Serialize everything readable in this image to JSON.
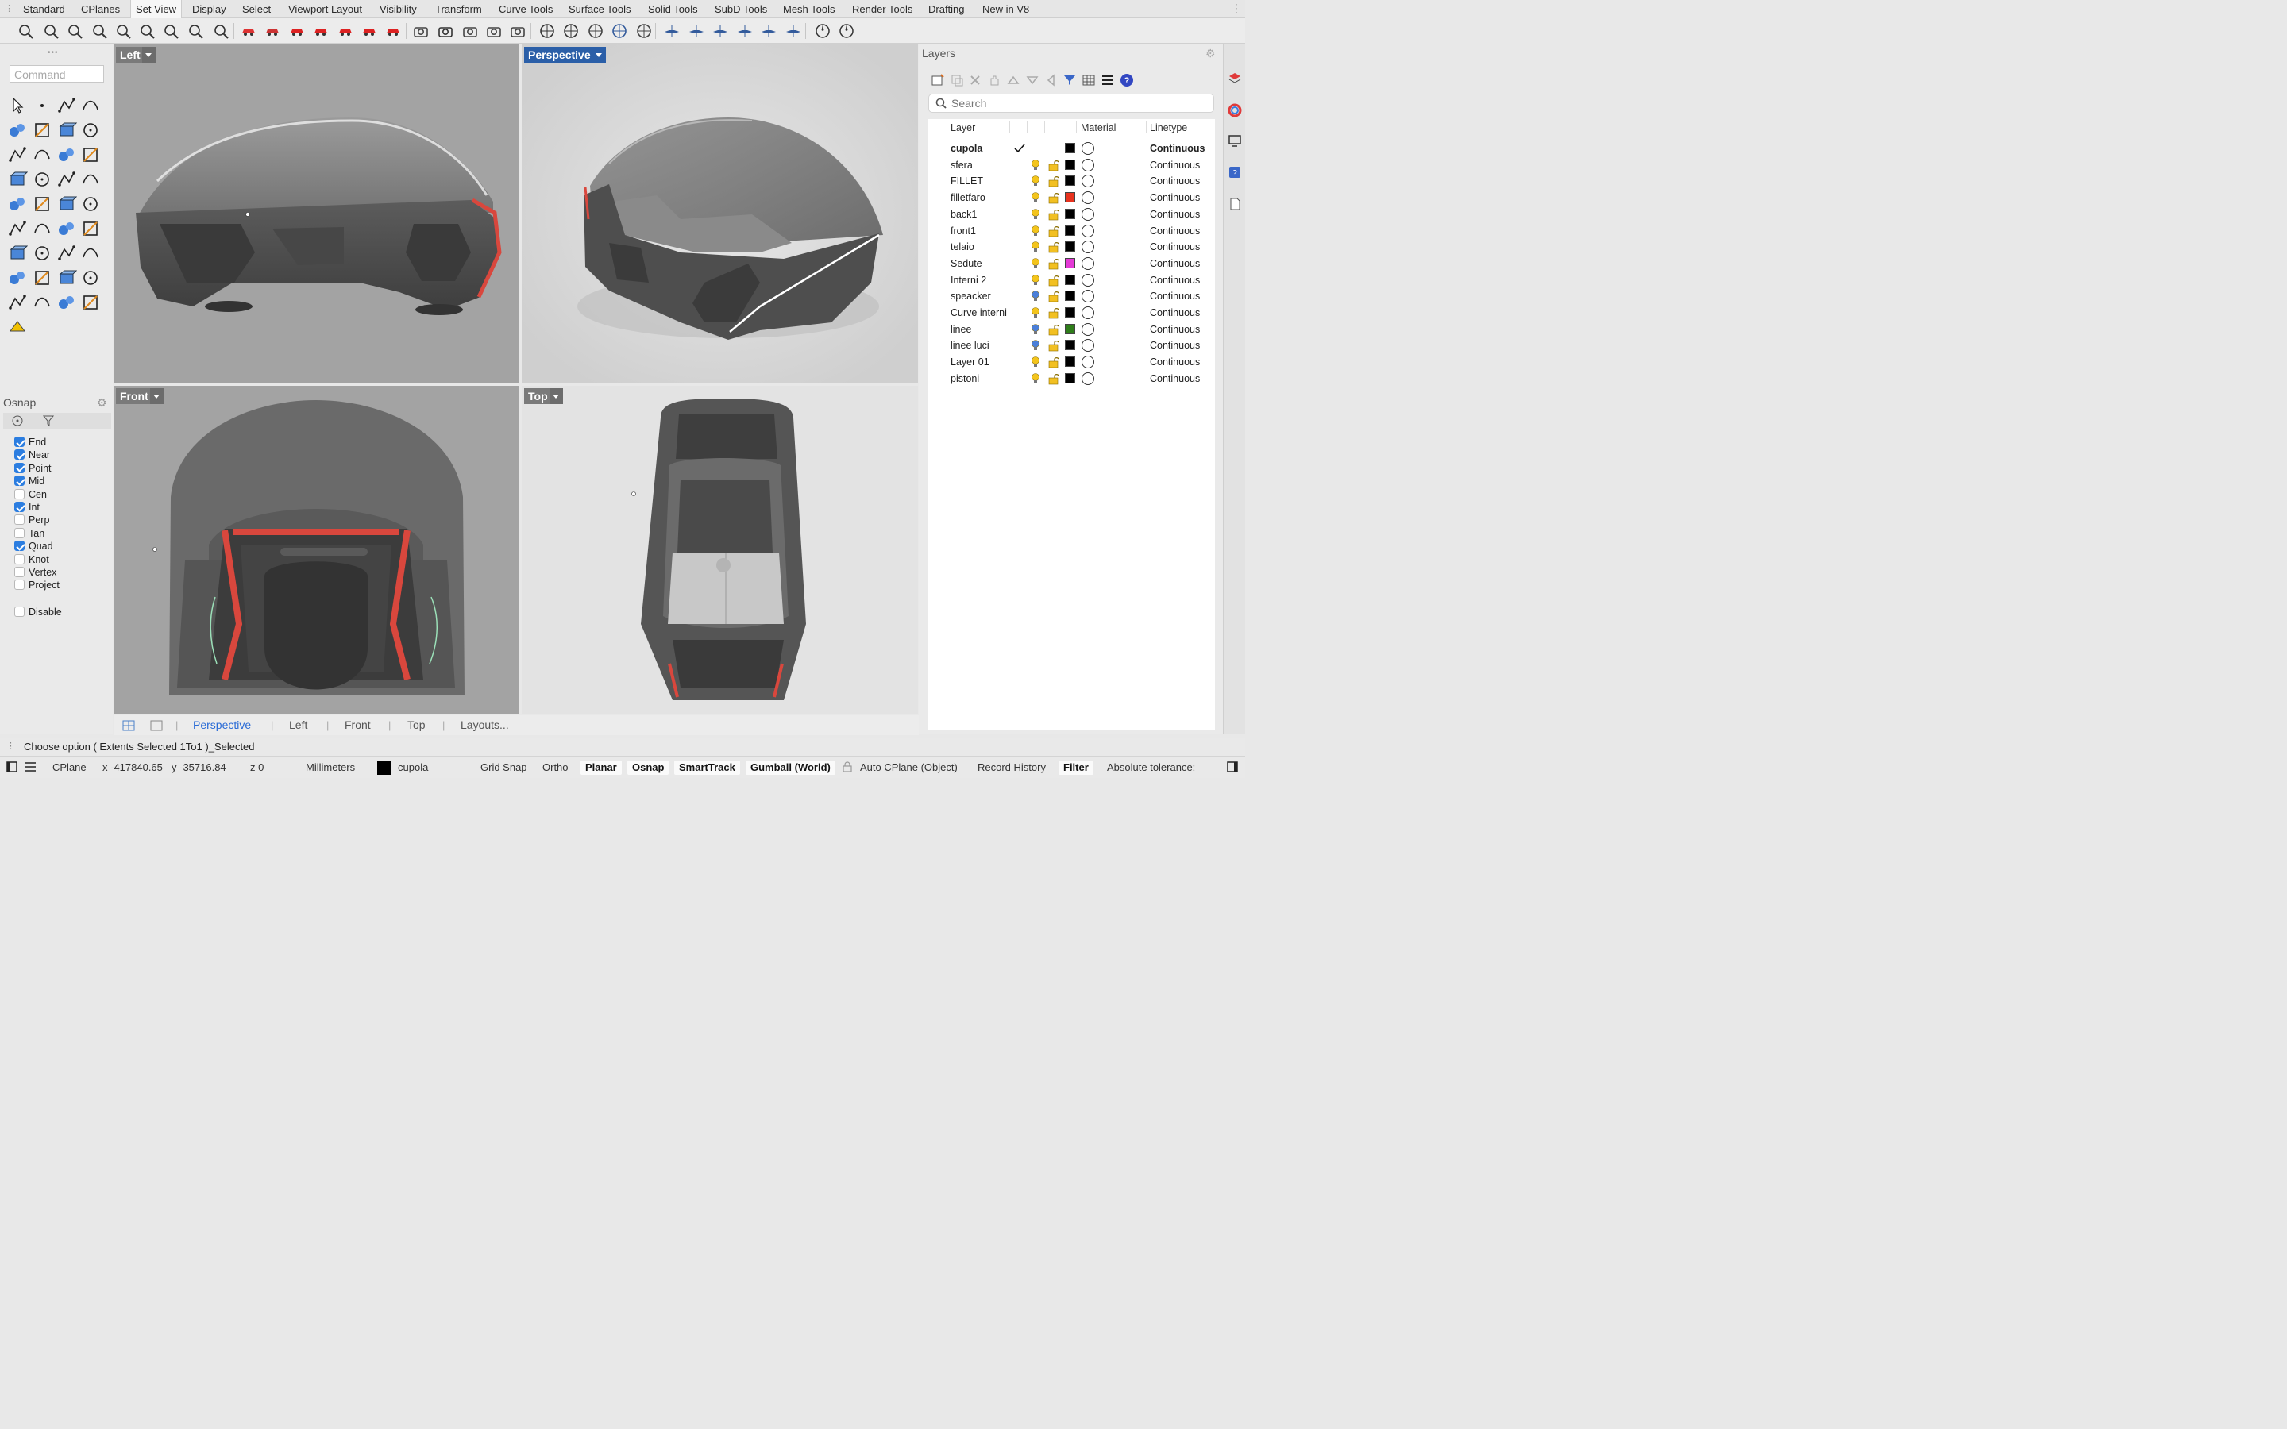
{
  "menu_tabs": [
    "Standard",
    "CPlanes",
    "Set View",
    "Display",
    "Select",
    "Viewport Layout",
    "Visibility",
    "Transform",
    "Curve Tools",
    "Surface Tools",
    "Solid Tools",
    "SubD Tools",
    "Mesh Tools",
    "Render Tools",
    "Drafting",
    "New in V8"
  ],
  "active_tab": "Set View",
  "toolbar_icons": [
    "pan-icon",
    "rotate-view-icon",
    "zoom-dynamic-icon",
    "zoom-extents-icon",
    "zoom-window-icon",
    "zoom-selected-icon",
    "undo-view-icon",
    "zoom-target-icon",
    "one-to-one-icon",
    "named-view-1-icon",
    "named-view-2-icon",
    "car-view-1-icon",
    "car-view-2-icon",
    "car-view-3-icon",
    "car-view-4-icon",
    "car-view-5-icon",
    "place-camera-icon",
    "camera-icon",
    "set-camera-icon",
    "set-target-icon",
    "set-lens-icon",
    "plan-view-icon",
    "cplane-origin-icon",
    "align-icon",
    "capture-view-icon",
    "perspective-cube-icon",
    "front-view-icon",
    "back-view-icon",
    "right-view-icon",
    "left-view-icon",
    "top-view-icon",
    "bottom-view-icon",
    "compass-icon",
    "reset-view-icon"
  ],
  "command": {
    "placeholder": "Command"
  },
  "tool_icons": [
    "select-arrow-icon",
    "point-icon",
    "polyline-icon",
    "curve-icon",
    "circle-icon",
    "ellipse-icon",
    "polygon-icon",
    "rectangle-icon",
    "arc-icon",
    "fillet-icon",
    "edit-points-icon",
    "extend-icon",
    "box-icon",
    "sphere-icon",
    "cylinder-icon",
    "surface-icon",
    "gumball-icon",
    "explode-icon",
    "split-icon",
    "trim-icon",
    "boolean-icon",
    "group-icon",
    "offset-icon",
    "blend-icon",
    "text-icon",
    "scale-icon",
    "array-icon",
    "edit-icon",
    "solid-icon",
    "array-linear-icon",
    "grid-icon",
    "dimension-icon",
    "transform-icon",
    "analyze-icon",
    "check-icon",
    "render-icon",
    "sub-menu-icon"
  ],
  "viewports": {
    "left": {
      "label": "Left"
    },
    "perspective": {
      "label": "Perspective"
    },
    "front": {
      "label": "Front"
    },
    "top": {
      "label": "Top"
    }
  },
  "viewport_tabs": [
    "Perspective",
    "Left",
    "Front",
    "Top",
    "Layouts..."
  ],
  "active_viewport_tab": "Perspective",
  "osnap": {
    "title": "Osnap",
    "items": [
      {
        "label": "End",
        "checked": true
      },
      {
        "label": "Near",
        "checked": true
      },
      {
        "label": "Point",
        "checked": true
      },
      {
        "label": "Mid",
        "checked": true
      },
      {
        "label": "Cen",
        "checked": false
      },
      {
        "label": "Int",
        "checked": true
      },
      {
        "label": "Perp",
        "checked": false
      },
      {
        "label": "Tan",
        "checked": false
      },
      {
        "label": "Quad",
        "checked": true
      },
      {
        "label": "Knot",
        "checked": false
      },
      {
        "label": "Vertex",
        "checked": false
      },
      {
        "label": "Project",
        "checked": false
      }
    ],
    "disable": {
      "label": "Disable",
      "checked": false
    }
  },
  "layers_panel": {
    "title": "Layers",
    "search_placeholder": "Search",
    "columns": {
      "layer": "Layer",
      "material": "Material",
      "linetype": "Linetype"
    },
    "rows": [
      {
        "name": "cupola",
        "current": true,
        "bulb": "yellow",
        "color": "#000000",
        "linetype": "Continuous"
      },
      {
        "name": "sfera",
        "current": false,
        "bulb": "yellow",
        "color": "#000000",
        "linetype": "Continuous"
      },
      {
        "name": "FILLET",
        "current": false,
        "bulb": "yellow",
        "color": "#000000",
        "linetype": "Continuous"
      },
      {
        "name": "filletfaro",
        "current": false,
        "bulb": "yellow",
        "color": "#e8321e",
        "linetype": "Continuous"
      },
      {
        "name": "back1",
        "current": false,
        "bulb": "yellow",
        "color": "#000000",
        "linetype": "Continuous"
      },
      {
        "name": "front1",
        "current": false,
        "bulb": "yellow",
        "color": "#000000",
        "linetype": "Continuous"
      },
      {
        "name": "telaio",
        "current": false,
        "bulb": "yellow",
        "color": "#000000",
        "linetype": "Continuous"
      },
      {
        "name": "Sedute",
        "current": false,
        "bulb": "yellow",
        "color": "#e43ad6",
        "linetype": "Continuous"
      },
      {
        "name": "Interni 2",
        "current": false,
        "bulb": "yellow",
        "color": "#000000",
        "linetype": "Continuous"
      },
      {
        "name": "speacker",
        "current": false,
        "bulb": "blue",
        "color": "#000000",
        "linetype": "Continuous"
      },
      {
        "name": "Curve interni",
        "current": false,
        "bulb": "yellow",
        "color": "#000000",
        "linetype": "Continuous"
      },
      {
        "name": "linee",
        "current": false,
        "bulb": "blue",
        "color": "#2e7d1a",
        "linetype": "Continuous"
      },
      {
        "name": "linee luci",
        "current": false,
        "bulb": "blue",
        "color": "#000000",
        "linetype": "Continuous"
      },
      {
        "name": "Layer 01",
        "current": false,
        "bulb": "yellow",
        "color": "#000000",
        "linetype": "Continuous"
      },
      {
        "name": "pistoni",
        "current": false,
        "bulb": "yellow",
        "color": "#000000",
        "linetype": "Continuous"
      }
    ]
  },
  "command_line": "Choose option ( Extents Selected 1To1 )_Selected",
  "status": {
    "cplane": "CPlane",
    "x": "x -417840.65",
    "y": "y -35716.84",
    "z": "z 0",
    "units": "Millimeters",
    "current_layer": "cupola",
    "grid_snap": "Grid Snap",
    "ortho": "Ortho",
    "planar": "Planar",
    "osnap": "Osnap",
    "smarttrack": "SmartTrack",
    "gumball": "Gumball (World)",
    "auto_cplane": "Auto CPlane (Object)",
    "record_history": "Record History",
    "filter": "Filter",
    "tolerance": "Absolute tolerance:"
  },
  "colors": {
    "accent": "#2b5fa8",
    "tab_blue": "#2a6bd6",
    "car_red": "#d9473d",
    "check_blue": "#2b7de0"
  }
}
